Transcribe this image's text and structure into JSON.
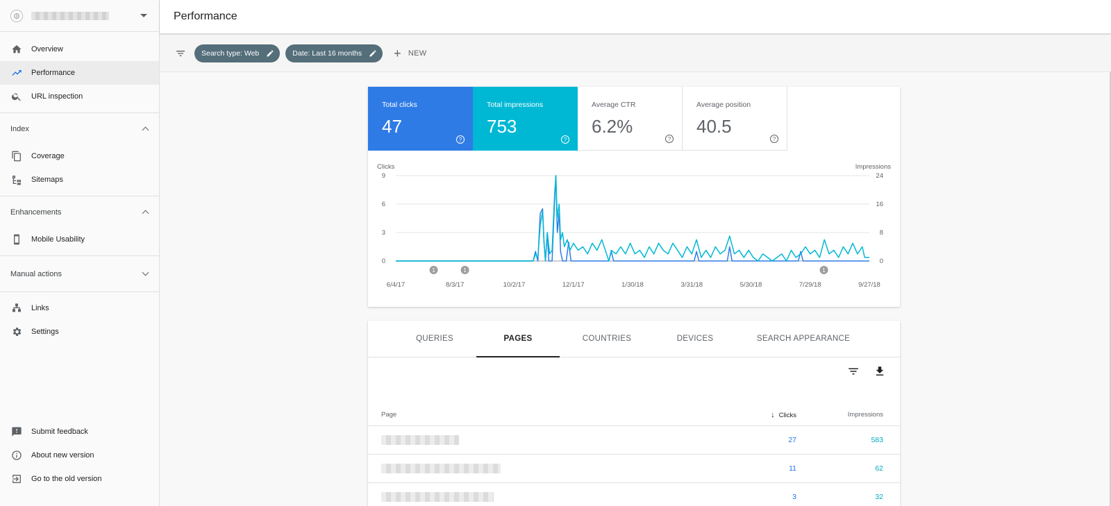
{
  "sidebar": {
    "top_items": [
      {
        "label": "Overview",
        "icon": "home-icon"
      },
      {
        "label": "Performance",
        "icon": "trending-up-icon",
        "active": true
      },
      {
        "label": "URL inspection",
        "icon": "search-icon"
      }
    ],
    "index": {
      "title": "Index",
      "items": [
        {
          "label": "Coverage",
          "icon": "copy-icon"
        },
        {
          "label": "Sitemaps",
          "icon": "sitemap-icon"
        }
      ]
    },
    "enhancements": {
      "title": "Enhancements",
      "items": [
        {
          "label": "Mobile Usability",
          "icon": "phone-icon"
        }
      ]
    },
    "manual_actions": {
      "title": "Manual actions"
    },
    "links": {
      "label": "Links",
      "icon": "links-icon"
    },
    "settings": {
      "label": "Settings",
      "icon": "gear-icon"
    },
    "bottom_items": [
      {
        "label": "Submit feedback",
        "icon": "feedback-icon"
      },
      {
        "label": "About new version",
        "icon": "info-icon"
      },
      {
        "label": "Go to the old version",
        "icon": "exit-icon"
      }
    ]
  },
  "header": {
    "title": "Performance"
  },
  "filters": {
    "chips": [
      "Search type: Web",
      "Date: Last 16 months"
    ],
    "new_label": "NEW"
  },
  "metrics": {
    "clicks": {
      "label": "Total clicks",
      "value": "47",
      "color": "#2f7be6"
    },
    "impressions": {
      "label": "Total impressions",
      "value": "753",
      "color": "#00b8d4"
    },
    "ctr": {
      "label": "Average CTR",
      "value": "6.2%"
    },
    "position": {
      "label": "Average position",
      "value": "40.5"
    }
  },
  "chart_data": {
    "type": "line",
    "ylabel_left": "Clicks",
    "ylabel_right": "Impressions",
    "yticks_left": [
      "0",
      "3",
      "6",
      "9"
    ],
    "yticks_right": [
      "0",
      "8",
      "16",
      "24"
    ],
    "ylim_left": [
      0,
      9
    ],
    "ylim_right": [
      0,
      24
    ],
    "x_ticks": [
      "6/4/17",
      "8/3/17",
      "10/2/17",
      "12/1/17",
      "1/30/18",
      "3/31/18",
      "5/30/18",
      "7/29/18",
      "9/27/18"
    ],
    "annotations": [
      {
        "x_fraction": 0.08,
        "label": "1"
      },
      {
        "x_fraction": 0.146,
        "label": "1"
      },
      {
        "x_fraction": 0.904,
        "label": "1"
      }
    ],
    "series": [
      {
        "name": "Clicks",
        "axis": "left",
        "color": "#2f7be6",
        "values": [
          [
            0,
            0
          ],
          [
            0.29,
            0
          ],
          [
            0.295,
            1
          ],
          [
            0.3,
            0
          ],
          [
            0.305,
            5
          ],
          [
            0.31,
            5.5
          ],
          [
            0.313,
            2
          ],
          [
            0.316,
            0
          ],
          [
            0.32,
            3
          ],
          [
            0.323,
            0
          ],
          [
            0.33,
            0
          ],
          [
            0.335,
            6
          ],
          [
            0.338,
            9
          ],
          [
            0.341,
            3
          ],
          [
            0.345,
            5
          ],
          [
            0.348,
            1
          ],
          [
            0.352,
            0
          ],
          [
            0.36,
            0
          ],
          [
            0.365,
            2
          ],
          [
            0.37,
            0
          ],
          [
            0.45,
            0
          ],
          [
            0.455,
            1
          ],
          [
            0.46,
            0
          ],
          [
            0.63,
            0
          ],
          [
            0.635,
            1
          ],
          [
            0.64,
            0
          ],
          [
            0.7,
            0
          ],
          [
            0.705,
            1.5
          ],
          [
            0.71,
            0
          ],
          [
            0.85,
            0
          ],
          [
            0.855,
            1
          ],
          [
            0.86,
            0
          ],
          [
            1,
            0
          ]
        ]
      },
      {
        "name": "Impressions",
        "axis": "right",
        "color": "#00b8d4",
        "values": [
          [
            0,
            0
          ],
          [
            0.29,
            0
          ],
          [
            0.295,
            2
          ],
          [
            0.3,
            1
          ],
          [
            0.305,
            10
          ],
          [
            0.31,
            14
          ],
          [
            0.313,
            5
          ],
          [
            0.316,
            0
          ],
          [
            0.32,
            8
          ],
          [
            0.325,
            2
          ],
          [
            0.33,
            3
          ],
          [
            0.335,
            18
          ],
          [
            0.338,
            24
          ],
          [
            0.341,
            12
          ],
          [
            0.345,
            16
          ],
          [
            0.348,
            6
          ],
          [
            0.352,
            8
          ],
          [
            0.356,
            4
          ],
          [
            0.362,
            6
          ],
          [
            0.368,
            3
          ],
          [
            0.375,
            5
          ],
          [
            0.385,
            3
          ],
          [
            0.395,
            4
          ],
          [
            0.405,
            2
          ],
          [
            0.415,
            5
          ],
          [
            0.425,
            3
          ],
          [
            0.435,
            6
          ],
          [
            0.445,
            2
          ],
          [
            0.45,
            0
          ],
          [
            0.455,
            3
          ],
          [
            0.465,
            2
          ],
          [
            0.475,
            4
          ],
          [
            0.485,
            2
          ],
          [
            0.495,
            5
          ],
          [
            0.505,
            2
          ],
          [
            0.515,
            3
          ],
          [
            0.525,
            1
          ],
          [
            0.535,
            4
          ],
          [
            0.545,
            2
          ],
          [
            0.555,
            5
          ],
          [
            0.565,
            3
          ],
          [
            0.575,
            2
          ],
          [
            0.585,
            5
          ],
          [
            0.595,
            3
          ],
          [
            0.605,
            1
          ],
          [
            0.615,
            4
          ],
          [
            0.625,
            2
          ],
          [
            0.635,
            6
          ],
          [
            0.645,
            1
          ],
          [
            0.655,
            3
          ],
          [
            0.665,
            1
          ],
          [
            0.675,
            4
          ],
          [
            0.685,
            2
          ],
          [
            0.695,
            3
          ],
          [
            0.705,
            7
          ],
          [
            0.715,
            2
          ],
          [
            0.725,
            3
          ],
          [
            0.735,
            1
          ],
          [
            0.745,
            3
          ],
          [
            0.755,
            1
          ],
          [
            0.765,
            0
          ],
          [
            0.775,
            2
          ],
          [
            0.785,
            1
          ],
          [
            0.795,
            0
          ],
          [
            0.805,
            1
          ],
          [
            0.815,
            2
          ],
          [
            0.825,
            0
          ],
          [
            0.835,
            3
          ],
          [
            0.845,
            1
          ],
          [
            0.855,
            2
          ],
          [
            0.865,
            4
          ],
          [
            0.875,
            2
          ],
          [
            0.885,
            3
          ],
          [
            0.895,
            1
          ],
          [
            0.905,
            6
          ],
          [
            0.915,
            2
          ],
          [
            0.925,
            3
          ],
          [
            0.935,
            1
          ],
          [
            0.945,
            4
          ],
          [
            0.955,
            2
          ],
          [
            0.965,
            5
          ],
          [
            0.975,
            2
          ],
          [
            0.985,
            4
          ],
          [
            0.99,
            1
          ],
          [
            1,
            1
          ]
        ]
      }
    ]
  },
  "table": {
    "tabs": [
      "QUERIES",
      "PAGES",
      "COUNTRIES",
      "DEVICES",
      "SEARCH APPEARANCE"
    ],
    "active_tab": "PAGES",
    "columns": {
      "page": "Page",
      "clicks": "Clicks",
      "impressions": "Impressions"
    },
    "rows": [
      {
        "clicks": "27",
        "impressions": "583"
      },
      {
        "clicks": "11",
        "impressions": "62"
      },
      {
        "clicks": "3",
        "impressions": "32"
      }
    ]
  }
}
